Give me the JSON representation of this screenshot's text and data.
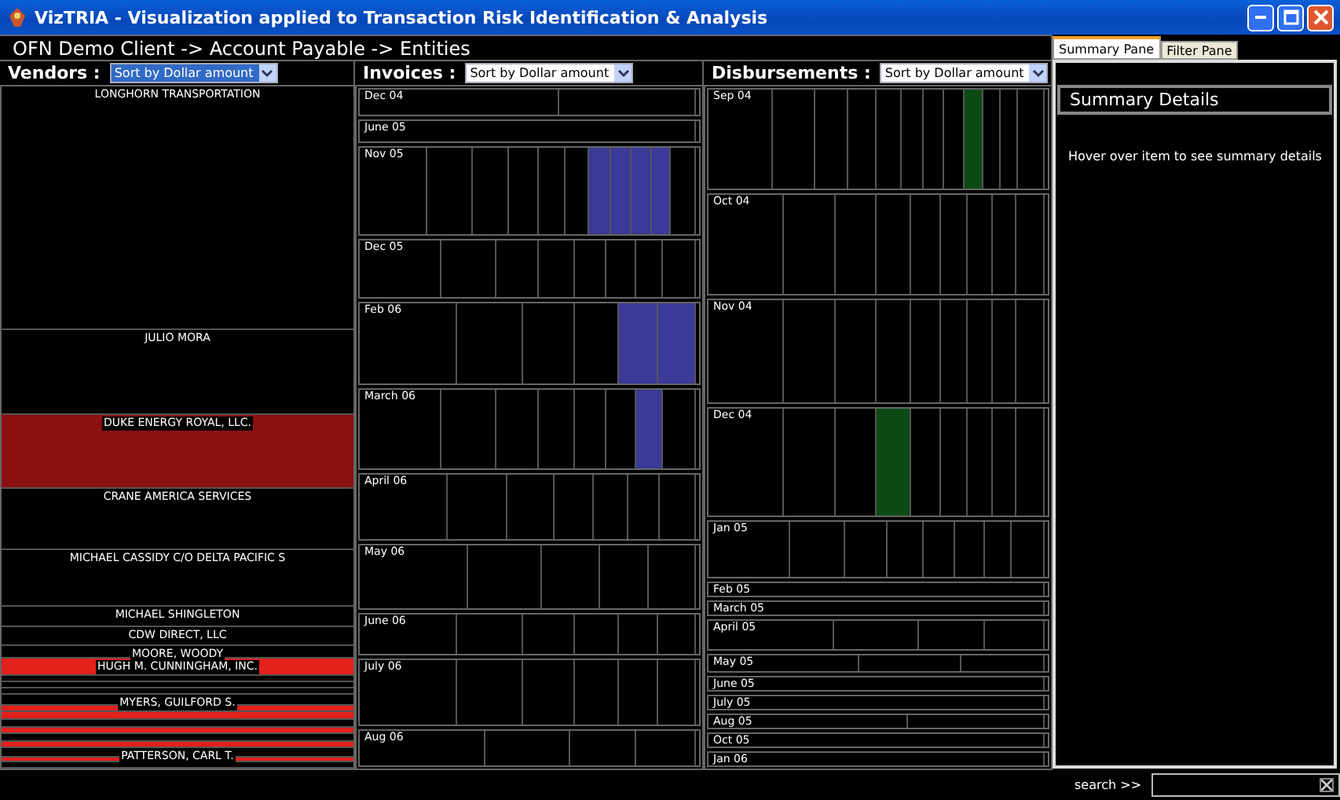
{
  "window": {
    "title": "VizTRIA - Visualization applied to Transaction Risk Identification & Analysis"
  },
  "breadcrumb": "OFN Demo Client -> Account Payable -> Entities",
  "vendors": {
    "label": "Vendors :",
    "sort": "Sort by Dollar amount",
    "sort_selected": true,
    "rows": [
      {
        "name": "LONGHORN TRANSPORTATION",
        "color": "#000000"
      },
      {
        "name": "JULIO MORA",
        "color": "#000000"
      },
      {
        "name": "DUKE ENERGY ROYAL, LLC.",
        "color": "#8b1010"
      },
      {
        "name": "CRANE AMERICA SERVICES",
        "color": "#000000"
      },
      {
        "name": "MICHAEL CASSIDY C/O DELTA PACIFIC S",
        "color": "#000000"
      },
      {
        "name": "MICHAEL SHINGLETON",
        "color": "#000000"
      },
      {
        "name": "CDW DIRECT, LLC",
        "color": "#000000"
      },
      {
        "name": "MOORE, WOODY",
        "color": "#000000"
      },
      {
        "name": "HUGH M. CUNNINGHAM, INC.",
        "color": "#e4201c"
      },
      {
        "color": "#000000"
      },
      {
        "color": "#000000"
      },
      {
        "color": "#000000"
      },
      {
        "name": "MYERS, GUILFORD S.",
        "color": "#000000"
      },
      {
        "color": "#e4201c"
      },
      {
        "color": "#e4201c"
      },
      {
        "color": "#000000"
      },
      {
        "color": "#e4201c"
      },
      {
        "color": "#000000"
      },
      {
        "color": "#e4201c"
      },
      {
        "name": "PATTERSON, CARL T.",
        "color": "#000000"
      },
      {
        "color": "#e4201c"
      },
      {
        "color": "#000000"
      }
    ]
  },
  "invoices": {
    "label": "Invoices :",
    "sort": "Sort by Dollar amount",
    "sort_selected": false,
    "months": [
      {
        "label": "Dec 04",
        "cells": [
          false,
          false
        ]
      },
      {
        "label": "June 05",
        "cells": [
          false
        ]
      },
      {
        "label": "Nov 05",
        "cells": [
          false,
          false,
          false,
          false,
          false,
          false,
          true,
          true,
          true,
          true,
          false
        ]
      },
      {
        "label": "Dec 05",
        "cells": [
          false,
          false,
          false,
          false,
          false,
          false,
          false,
          false
        ]
      },
      {
        "label": "Feb 06",
        "cells": [
          false,
          false,
          false,
          false,
          true,
          true
        ]
      },
      {
        "label": "March 06",
        "cells": [
          false,
          false,
          false,
          false,
          false,
          false,
          true,
          false
        ]
      },
      {
        "label": "April 06",
        "cells": [
          false,
          false,
          false,
          false,
          false,
          false,
          false
        ]
      },
      {
        "label": "May 06",
        "cells": [
          false,
          false,
          false,
          false,
          false
        ]
      },
      {
        "label": "June 06",
        "cells": [
          false,
          false,
          false,
          false,
          false,
          false
        ]
      },
      {
        "label": "July 06",
        "cells": [
          false,
          false,
          false,
          false,
          false,
          false
        ]
      },
      {
        "label": "Aug 06",
        "cells": [
          false,
          false,
          false,
          false
        ]
      }
    ]
  },
  "disbursements": {
    "label": "Disbursements :",
    "sort": "Sort by Dollar amount",
    "sort_selected": false,
    "months": [
      {
        "label": "Sep 04",
        "cells": [
          false,
          false,
          false,
          false,
          false,
          false,
          false,
          false,
          true,
          false,
          false,
          false
        ]
      },
      {
        "label": "Oct 04",
        "cells": [
          false,
          false,
          false,
          false,
          false,
          false,
          false,
          false,
          false
        ]
      },
      {
        "label": "Nov 04",
        "cells": [
          false,
          false,
          false,
          false,
          false,
          false,
          false,
          false,
          false
        ]
      },
      {
        "label": "Dec 04",
        "cells": [
          false,
          false,
          false,
          true,
          false,
          false,
          false,
          false,
          false
        ]
      },
      {
        "label": "Jan 05",
        "cells": [
          false,
          false,
          false,
          false,
          false,
          false,
          false,
          false
        ]
      },
      {
        "label": "Feb 05",
        "cells": [
          false
        ]
      },
      {
        "label": "March 05",
        "cells": [
          false
        ]
      },
      {
        "label": "April 05",
        "cells": [
          false,
          false,
          false,
          false
        ]
      },
      {
        "label": "May 05",
        "cells": [
          false,
          false,
          false
        ]
      },
      {
        "label": "June 05",
        "cells": [
          false
        ]
      },
      {
        "label": "July 05",
        "cells": [
          false
        ]
      },
      {
        "label": "Aug 05",
        "cells": [
          false,
          false
        ]
      },
      {
        "label": "Oct 05",
        "cells": [
          false
        ]
      },
      {
        "label": "Jan 06",
        "cells": [
          false
        ]
      }
    ]
  },
  "tabs": [
    {
      "label": "Summary Pane",
      "selected": true
    },
    {
      "label": "Filter Pane",
      "selected": false
    }
  ],
  "summary": {
    "title": "Summary Details",
    "hint": "Hover over item to see summary details"
  },
  "search": {
    "label": "search >>"
  }
}
